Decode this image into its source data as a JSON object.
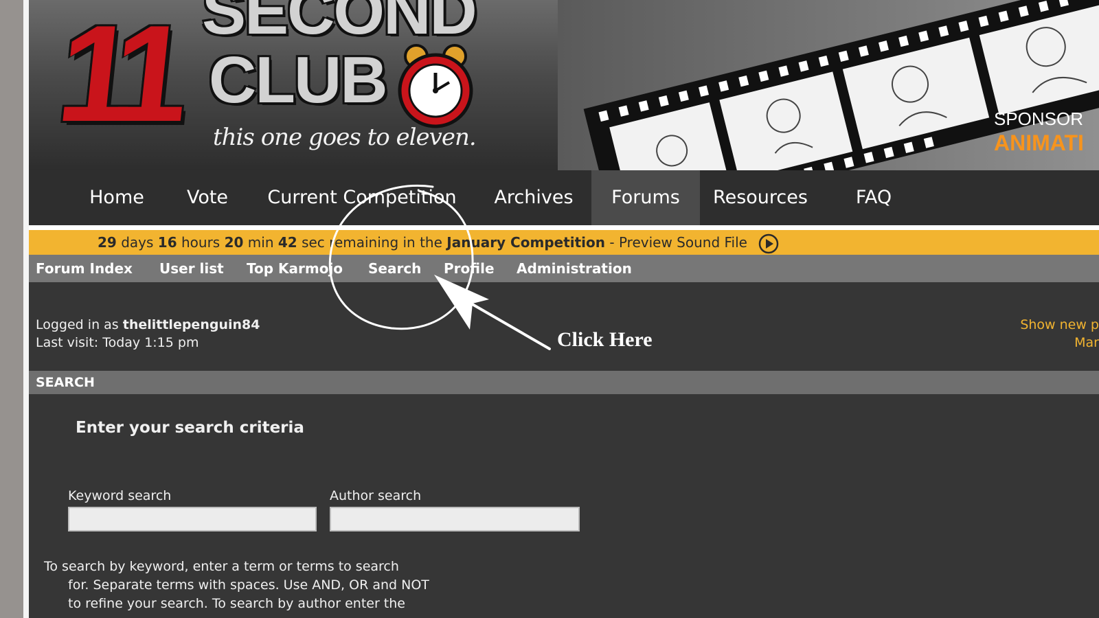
{
  "header": {
    "logo_number": "11",
    "logo_word1": "SECOND",
    "logo_word2": "CLUB",
    "tagline": "this one goes to eleven.",
    "sponsor_label": "SPONSOR",
    "sponsor_brand": "ANIMATI",
    "logo_colors": {
      "red": "#c9141b",
      "gray": "#d2d2d2"
    }
  },
  "nav": {
    "items": [
      {
        "label": "Home"
      },
      {
        "label": "Vote"
      },
      {
        "label": "Current Competition"
      },
      {
        "label": "Archives"
      },
      {
        "label": "Forums",
        "active": true
      },
      {
        "label": "Resources"
      },
      {
        "label": "FAQ"
      }
    ]
  },
  "competition": {
    "days": "29",
    "days_unit": "days",
    "hours": "16",
    "hours_unit": "hours",
    "minutes": "20",
    "minutes_unit": "min",
    "seconds": "42",
    "seconds_unit": "sec",
    "remaining_text": "remaining in the",
    "competition_name": "January Competition",
    "preview_link": "- Preview Sound File",
    "play_icon": "play-circle-icon",
    "accent": "#f2b430"
  },
  "forum_nav": {
    "items": [
      {
        "label": "Forum Index"
      },
      {
        "label": "User list"
      },
      {
        "label": "Top Karmojo"
      },
      {
        "label": "Search"
      },
      {
        "label": "Profile"
      },
      {
        "label": "Administration"
      }
    ]
  },
  "user": {
    "logged_in_prefix": "Logged in as",
    "username": "thelittlepenguin84",
    "last_visit": "Last visit: Today 1:15 pm"
  },
  "right_links": {
    "show_new": "Show new p",
    "mark": "Mar"
  },
  "search": {
    "section_title": "SEARCH",
    "criteria_heading": "Enter your search criteria",
    "keyword_label": "Keyword search",
    "keyword_value": "",
    "author_label": "Author search",
    "author_value": "",
    "help_lines": [
      "To search by keyword, enter a term or terms to search",
      "for. Separate terms with spaces. Use AND, OR and NOT",
      "to refine your search. To search by author enter the"
    ]
  },
  "annotation": {
    "text": "Click Here",
    "color": "#ffffff"
  }
}
